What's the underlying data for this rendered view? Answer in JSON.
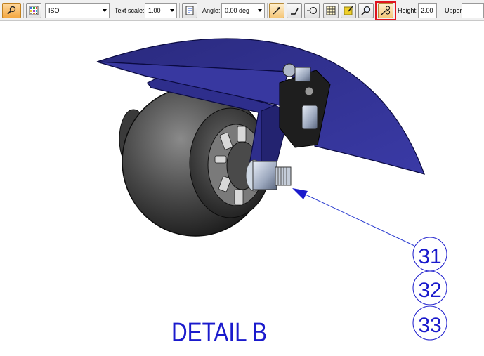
{
  "toolbar": {
    "standard_value": "ISO",
    "text_scale_label": "Text scale:",
    "text_scale_value": "1.00",
    "angle_label": "Angle:",
    "angle_value": "0.00 deg",
    "height_label": "Height:",
    "height_value": "2.00",
    "upper_label": "Upper:",
    "upper_value": ""
  },
  "drawing": {
    "detail_label": "DETAIL B",
    "balloons": [
      "31",
      "32",
      "33"
    ]
  },
  "colors": {
    "accent_orange": "#f3a843",
    "highlight_red": "#e0141e",
    "annotation_blue": "#1a1acc",
    "fender_blue": "#2e2e8c"
  }
}
